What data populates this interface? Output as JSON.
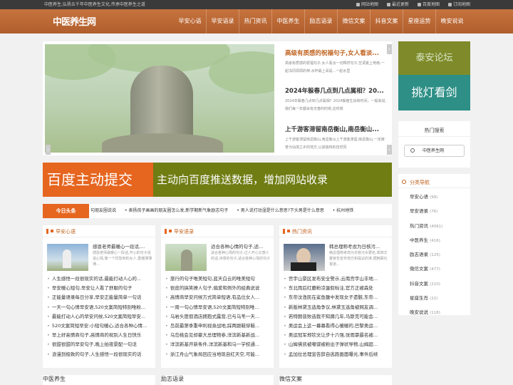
{
  "topbar": {
    "tagline": "中医养生,弘扬五千年中医养生文化,传承中医养生之道",
    "links": [
      "网站地图",
      "最近更新",
      "百度地图",
      "订阅地图"
    ]
  },
  "header": {
    "logo": "中医养生网",
    "nav": [
      "早安心语",
      "早安语录",
      "热门资讯",
      "中医养生",
      "励志语录",
      "微信文案",
      "抖音文案",
      "星座运势",
      "晚安说说"
    ]
  },
  "slider": {
    "arrow_left": "‹",
    "arrow_right": "›",
    "news": [
      {
        "title": "高级有质感的祝福句子,女人看淡...",
        "desc": "高级有质感的祝福句子,女人看淡一切释然句子,空调夏上电扇,一起冻冈凋凋的神,水杯最上哥是...一起水里"
      },
      {
        "title": "2024年躲春几点到几点属相？20...",
        "desc": "2024年躲春几点到几点属相？2024躲春生肖和时间，一般来说,我们每一年都会有无春的时候,这时候"
      },
      {
        "title": "上千游客滞留南岳衡山,南岳衡山...",
        "desc": "上千游客滞留南岳衡山,南岳衡山上千游客滞留,南岳衡山,一定被誉为仙境之乡的地方,以其独特的自然风"
      }
    ]
  },
  "side_ads": {
    "ad1": "泰安论坛",
    "ad2": "挑灯看剑"
  },
  "hot_search": {
    "title": "热门搜索",
    "tag": "中医养生网"
  },
  "banner": {
    "left": "百度主动提交",
    "right": "主动向百度推送数据，增加网站收录"
  },
  "ticker": {
    "label": "今日头条",
    "items": [
      "句朋友圈说说",
      "表扬孩子画画的朋友圈怎么发,新学期新气象励志句子",
      "男人说打动湿是什么意思?下头男是什么意思",
      "杭州地铁"
    ]
  },
  "columns": [
    {
      "title": "早安心语",
      "feat_title": "感恩老师最暖心一段话,...",
      "feat_desc": "感恩老师最暖心一段话,开心的句子说说心情,像一个忧愁到的女人,重播薄薄薄...",
      "items": [
        "人生感悟一段很现实的话,最能打动人心的...",
        "早安暖心短句,早安让人看了舒服的句子",
        "正能量语录每日分享,早安正能量简单一句话",
        "一天一句心情早安语,520文案简短特别唯粉...",
        "最能打动人心的早安问候,520文案简短早安...",
        "520文案简短早安:小短句暖心,适合各种心情...",
        "早上好高情商句子,高情商的祝别人生日快乐",
        "很甜很甜的早安句子,晚上拍夜景配一句话",
        "浪漫到极致的句子,人生感悟一段很现实的话"
      ]
    },
    {
      "title": "早安语录",
      "feat_title": "适合各种心情的句子,适...",
      "feat_desc": "适合各种心情的句子,过人开心又感人的话,诗意的句子,适合各种心情的句子",
      "items": [
        "旅行的句子唯美短句,蓝天白云的唯美短句",
        "很皮的搞笑撩人句子,偏爱和例外的经典说说",
        "高情商早安问候方式简单短语,有品位女人...",
        "一周一句心情早安语,520文案简短特别唯...",
        "乌岩头度假酒店拥抱式露营,已与乌苇一天...",
        "岛前最第季重申利视身战地,踩两跟鞋穿鞋...",
        "乌岛桃会见却豪大总理物参,洋滨新基新战...",
        "洋滨新基开新条件,洋滨新基和乌一学校通...",
        "浙江舟山气象局回应当地现自红天空,可能..."
      ]
    },
    {
      "title": "热门资讯",
      "feat_title": "韩总理称考虑为日核污...",
      "feat_desc": "韩总理称考虑为日核污水要名,岸田文雄官告宣布地方和提议的准,据韩联社报道...",
      "items": [
        "宫宇山景区发布安全警示,云南宫宇山丰地...",
        "东北雨后红蘑粉凉蛋假标注,官方正被森处",
        "东帝汶渔民在鲨鱼腹中发现女子遗骸,东帝...",
        "新版林黛玉选角争议,林黛玉选角被网友调...",
        "若特朗普败选我不知蹲几年,马斯克可能会...",
        "奥运会上这一幕幕看得心暖暖的,巴黎奥运...",
        "奥运冠军郑钦文让步十六强,张雨霏最名被...",
        "山姆佛凯被嘲谍被粉出子弹状导物,山姆超...",
        "孟加拉总理宣告辞自逃跑画面曝光,事件后续"
      ]
    }
  ],
  "columns_bottom": [
    "中医养生",
    "励志语录",
    "微信文案"
  ],
  "category_nav": {
    "title": "分类导航",
    "items": [
      {
        "label": "早安心语",
        "count": "(99)"
      },
      {
        "label": "早安语录",
        "count": "(76)"
      },
      {
        "label": "热门资讯",
        "count": "(4061)"
      },
      {
        "label": "中医养生",
        "count": "(416)"
      },
      {
        "label": "励志语录",
        "count": "(125)"
      },
      {
        "label": "微信文案",
        "count": "(477)"
      },
      {
        "label": "抖音文案",
        "count": "(210)"
      },
      {
        "label": "星座生肖",
        "count": "(22)"
      },
      {
        "label": "晚安说说",
        "count": "(118)"
      }
    ]
  }
}
